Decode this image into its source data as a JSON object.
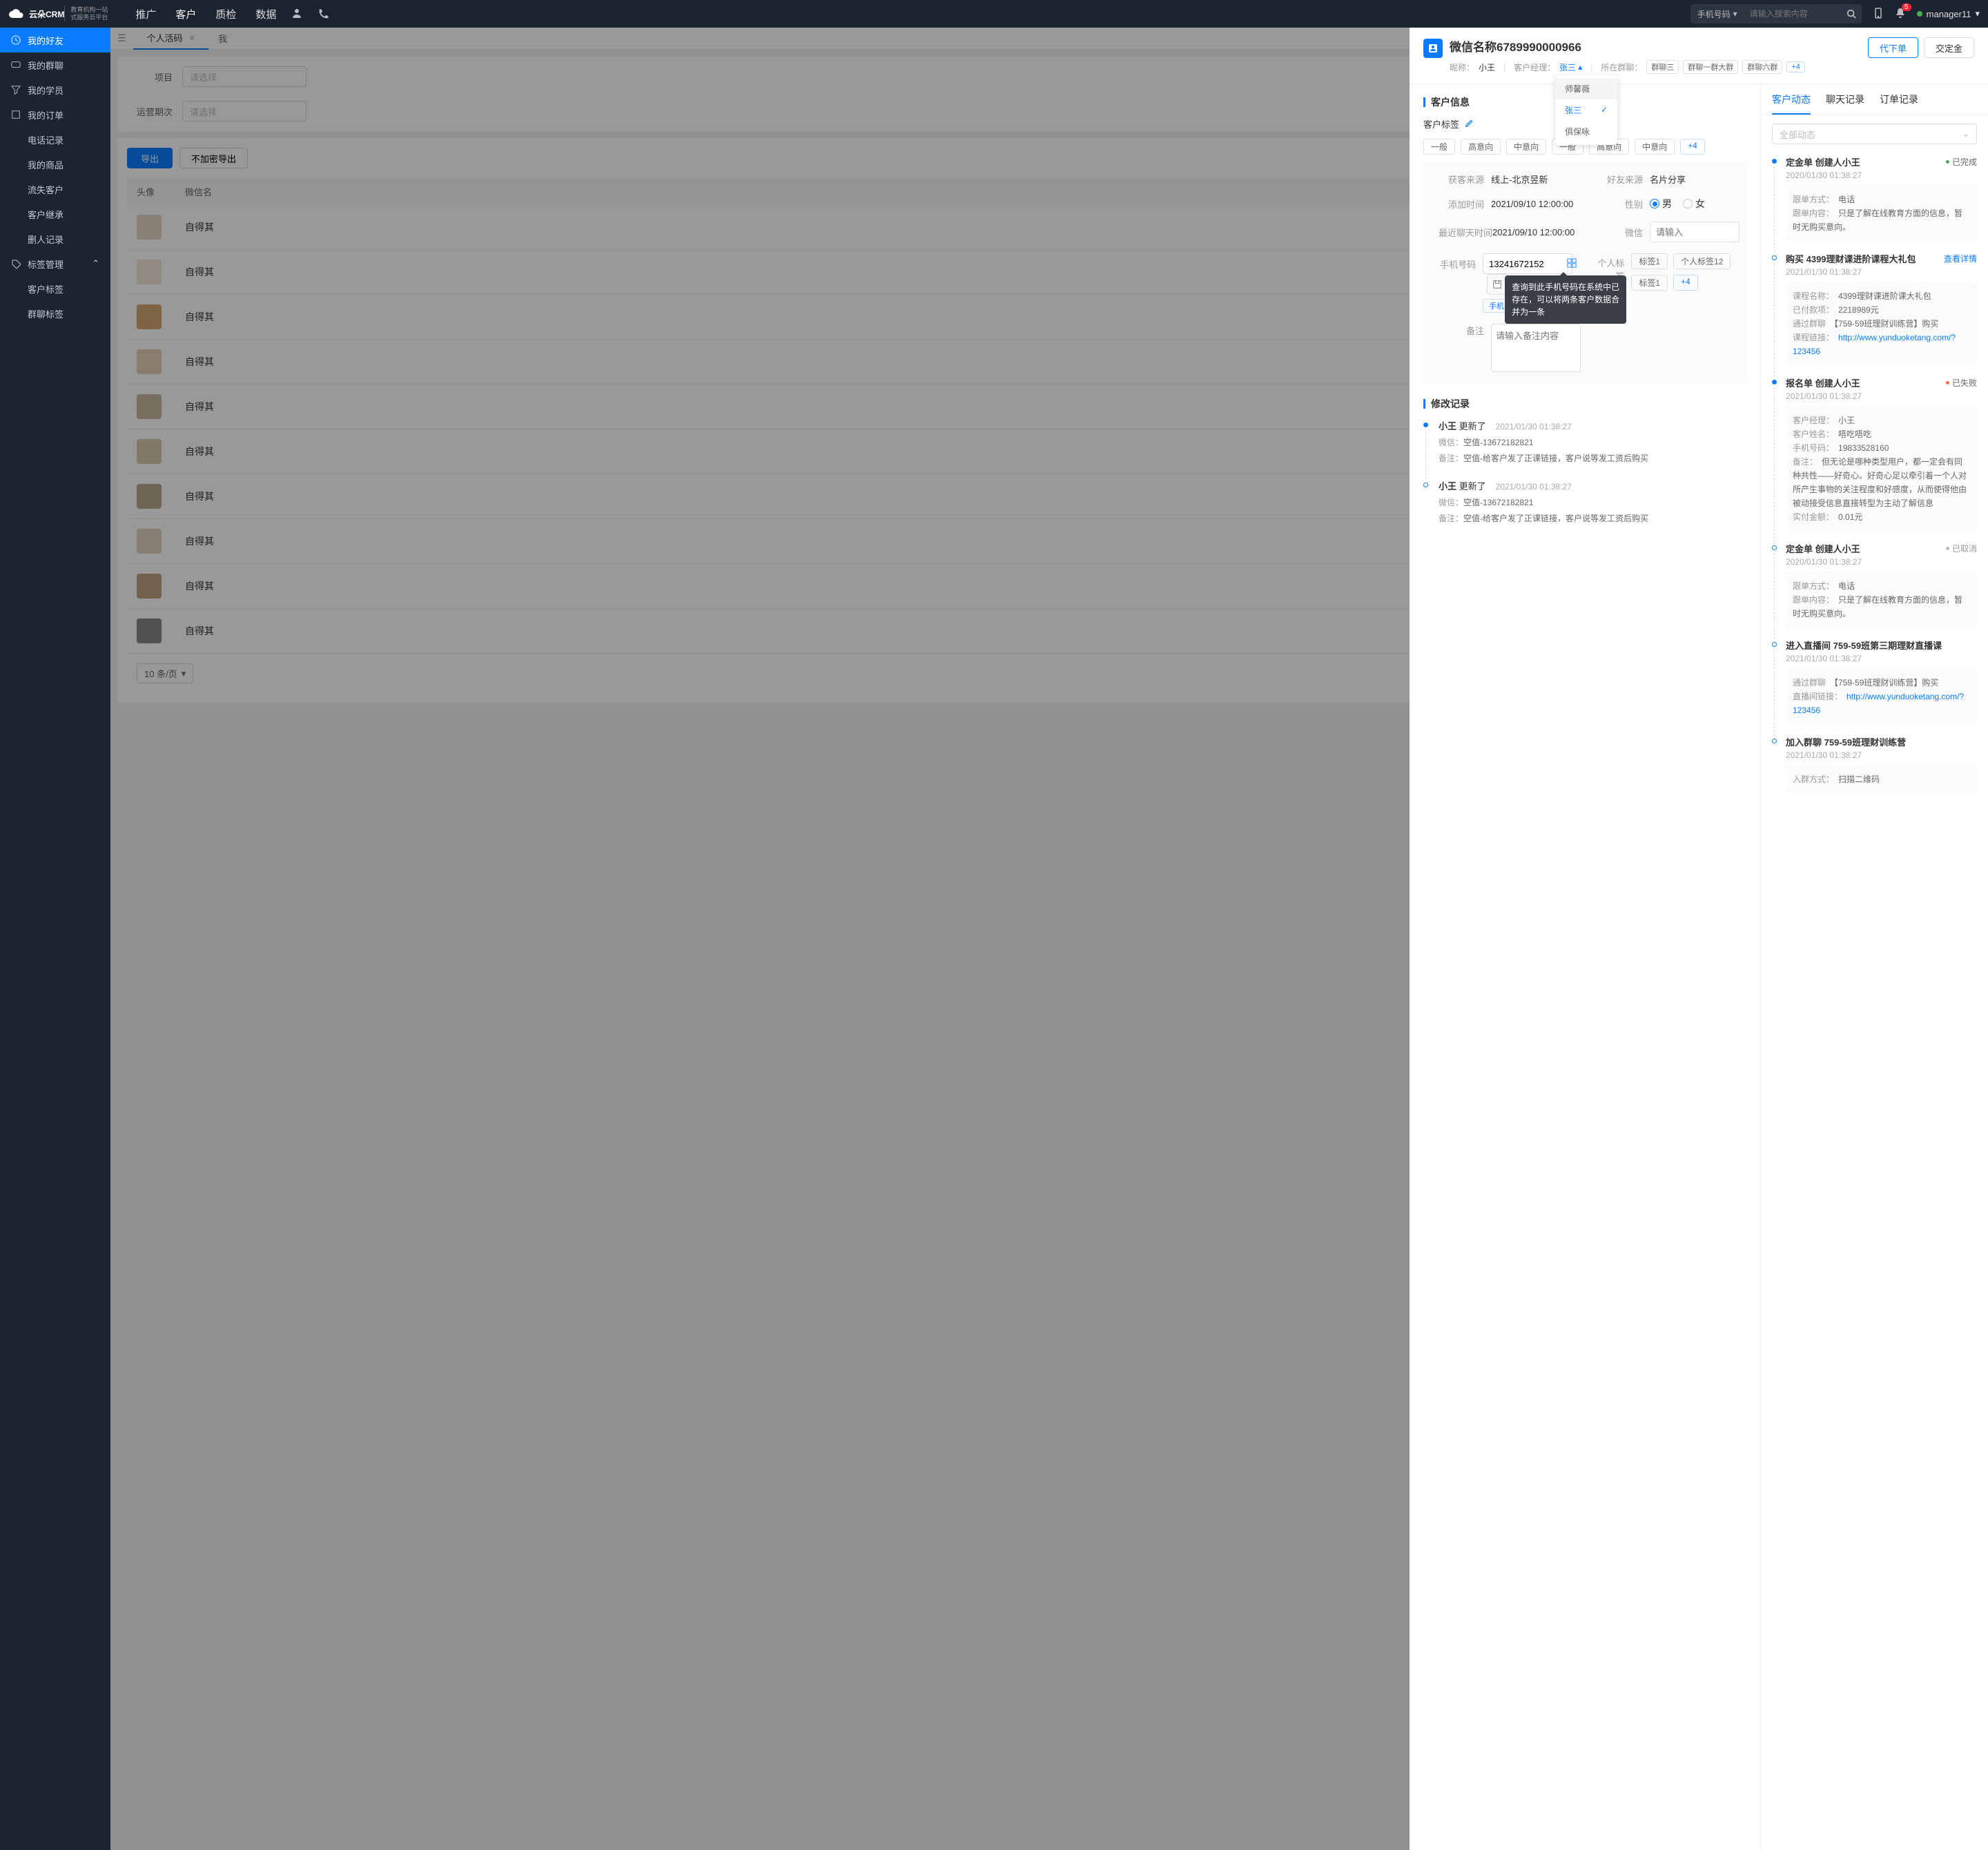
{
  "nav": {
    "brand": "云朵CRM",
    "brand_sub1": "教育机构一站",
    "brand_sub2": "式服务云平台",
    "tabs": [
      "推广",
      "客户",
      "质检",
      "数据"
    ],
    "active_tab": 1,
    "search_type": "手机号码",
    "search_ph": "请输入搜索内容",
    "badge": "5",
    "user": "manager11"
  },
  "sidebar": {
    "items": [
      "我的好友",
      "我的群聊",
      "我的学员",
      "我的订单",
      "电话记录",
      "我的商品",
      "流失客户",
      "客户继承",
      "删人记录",
      "标签管理"
    ],
    "sub": [
      "客户标签",
      "群聊标签"
    ]
  },
  "page": {
    "tab": "个人活码",
    "tab2": "我",
    "f1_label": "项目",
    "f2_label": "运营期次",
    "ph": "请选择",
    "export": "导出",
    "export2": "不加密导出",
    "col_av": "头像",
    "col_wx": "微信名",
    "row_txt": "自得其",
    "page_size": "10 条/页"
  },
  "drawer": {
    "title": "微信名称6789990000966",
    "nick_l": "昵称：",
    "nick_v": "小王",
    "mgr_l": "客户经理：",
    "mgr_v": "张三",
    "dropdown": [
      "师馨薇",
      "张三",
      "俱保咏"
    ],
    "group_l": "所在群聊：",
    "groups": [
      "群聊三",
      "群聊一群大群",
      "群聊六群"
    ],
    "group_more": "+4",
    "btn1": "代下单",
    "btn2": "交定金",
    "sec_info": "客户信息",
    "sec_tags": "客户标签",
    "tags": [
      "一般",
      "高意向",
      "中意向",
      "一般",
      "高意向",
      "中意向"
    ],
    "tag_more": "+4",
    "info": {
      "src_l": "获客来源",
      "src_v": "线上-北京昱新",
      "fr_l": "好友来源",
      "fr_v": "名片分享",
      "add_l": "添加时间",
      "add_v": "2021/09/10 12:00:00",
      "sex_l": "性别",
      "sex_m": "男",
      "sex_f": "女",
      "chat_l": "最近聊天时间",
      "chat_v": "2021/09/10 12:00:00",
      "wx_l": "微信",
      "wx_ph": "请输入",
      "ph_l": "手机号码",
      "ph_v": "13241672152",
      "ph_pill": "手机",
      "ptag_l": "个人标签",
      "ptags": [
        "标签1",
        "个人标签12",
        "标签1"
      ],
      "ptag_more": "+4",
      "note_l": "备注",
      "note_ph": "请输入备注内容",
      "tooltip": "查询到此手机号码在系统中已存在，可以将两条客户数据合并为一条"
    },
    "sec_log": "修改记录",
    "logs": [
      {
        "who": "小王",
        "act": "更新了",
        "time": "2021/01/30  01:38:27",
        "wx": "空值-13672182821",
        "note": "空值-给客户发了正课链接，客户说等发工资后购买"
      },
      {
        "who": "小王",
        "act": "更新了",
        "time": "2021/01/30  01:38:27",
        "wx": "空值-13672182821",
        "note": "空值-给客户发了正课链接，客户说等发工资后购买"
      }
    ],
    "log_wx": "微信：",
    "log_note": "备注："
  },
  "right": {
    "tabs": [
      "客户动态",
      "聊天记录",
      "订单记录"
    ],
    "filter": "全部动态",
    "view_detail": "查看详情",
    "feed": [
      {
        "type": "solid",
        "title": "定金单 创建人小王",
        "time": "2020/01/30  01:38:27",
        "status": "已完成",
        "color": "#4caf50",
        "card": [
          [
            "跟单方式：",
            "电话"
          ],
          [
            "跟单内容：",
            "只是了解在线教育方面的信息，暂时无购买意向。"
          ]
        ]
      },
      {
        "type": "ring",
        "title": "购买 4399理财课进阶课程大礼包",
        "time": "2021/01/30  01:38:27",
        "detail": true,
        "card": [
          [
            "课程名称：",
            "4399理财课进阶课大礼包"
          ],
          [
            "已付款项：",
            "2218989元"
          ],
          [
            "通过群聊",
            "【759-59班理财训练营】购买"
          ],
          [
            "课程链接：",
            "http://www.yunduoketang.com/?123456"
          ]
        ],
        "link": 3
      },
      {
        "type": "solid",
        "title": "报名单 创建人小王",
        "time": "2021/01/30  01:38:27",
        "status": "已失败",
        "color": "#ff6a3f",
        "card": [
          [
            "客户经理：",
            "小王"
          ],
          [
            "客户姓名：",
            "唔吃唔吃"
          ],
          [
            "手机号码：",
            "19833528160"
          ],
          [
            "备注：",
            "但无论是哪种类型用户，都一定会有同种共性——好奇心。好奇心足以牵引着一个人对所产生事物的关注程度和好感度，从而使得他由被动接受信息直接转型为主动了解信息"
          ],
          [
            "实付金额：",
            "0.01元"
          ]
        ]
      },
      {
        "type": "ring",
        "title": "定金单 创建人小王",
        "time": "2020/01/30  01:38:27",
        "status": "已取消",
        "color": "#bbb",
        "card": [
          [
            "跟单方式：",
            "电话"
          ],
          [
            "跟单内容：",
            "只是了解在线教育方面的信息，暂时无购买意向。"
          ]
        ]
      },
      {
        "type": "ring",
        "title": "进入直播间 759-59班第三期理财直播课",
        "time": "2021/01/30  01:38:27",
        "card": [
          [
            "通过群聊",
            "【759-59班理财训练营】购买"
          ],
          [
            "直播间链接：",
            "http://www.yunduoketang.com/?123456"
          ]
        ],
        "link": 1
      },
      {
        "type": "ring",
        "title": "加入群聊 759-59班理财训练营",
        "time": "2021/01/30  01:38:27",
        "card": [
          [
            "入群方式：",
            "扫描二维码"
          ]
        ]
      }
    ]
  }
}
